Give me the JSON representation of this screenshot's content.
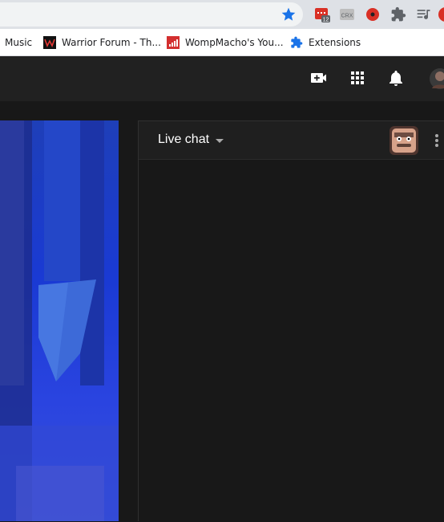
{
  "bookmarks": [
    {
      "label": "Music",
      "icon": "music-bookmark-icon"
    },
    {
      "label": "Warrior Forum - Th...",
      "icon": "warrior-forum-icon"
    },
    {
      "label": "WompMacho's You...",
      "icon": "analytics-bars-icon"
    },
    {
      "label": "Extensions",
      "icon": "puzzle-icon"
    }
  ],
  "extensions": {
    "badge_count": "12",
    "crx_label": "CRX"
  },
  "masthead": {
    "create_icon": "video-camera-plus-icon",
    "apps_icon": "apps-grid-icon",
    "notifications_icon": "bell-icon",
    "avatar_icon": "account-avatar"
  },
  "live_chat": {
    "title": "Live chat",
    "menu_icon": "more-vertical-icon"
  },
  "colors": {
    "masthead_bg": "#212121",
    "page_bg": "#181818",
    "chat_header_bg": "#1f1f1f",
    "star_blue": "#1a73e8",
    "video_blue": "#1e3fb8"
  }
}
